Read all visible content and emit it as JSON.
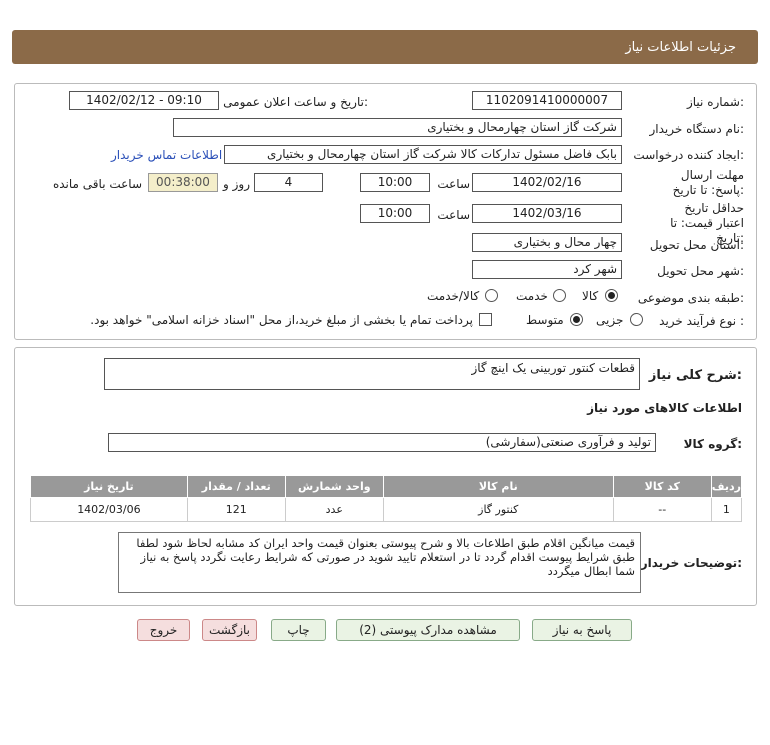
{
  "header": {
    "title": "جزئیات اطلاعات نیاز"
  },
  "form": {
    "need_number_label": "شماره نیاز:",
    "need_number": "1102091410000007",
    "announce_label": "تاریخ و ساعت اعلان عمومی:",
    "announce_value": "1402/02/12 - 09:10",
    "buyer_org_label": "نام دستگاه خریدار:",
    "buyer_org": "شرکت گاز استان چهارمحال و بختیاری",
    "requester_label": "ایجاد کننده درخواست:",
    "requester": "بابک فاضل  مسئول تدارکات کالا شرکت گاز استان چهارمحال و بختیاری",
    "contact_link": "اطلاعات تماس خریدار",
    "deadline_label": "مهلت ارسال پاسخ: تا تاریخ:",
    "deadline_date": "1402/02/16",
    "time_label": "ساعت",
    "deadline_time": "10:00",
    "days_value": "4",
    "days_label": "روز و",
    "remaining_time": "00:38:00",
    "remaining_label": "ساعت باقی مانده",
    "validity_label": "حداقل تاریخ اعتبار قیمت: تا تاریخ:",
    "validity_date": "1402/03/16",
    "validity_time": "10:00",
    "delivery_province_label": "استان محل تحویل:",
    "delivery_province": "چهار محال و بختیاری",
    "delivery_city_label": "شهر محل تحویل:",
    "delivery_city": "شهر کرد",
    "category_label": "طبقه بندی موضوعی:",
    "category_options": [
      "کالا",
      "خدمت",
      "کالا/خدمت"
    ],
    "category_selected": "کالا",
    "process_label": "نوع فرآیند خرید :",
    "process_options": [
      "جزیی",
      "متوسط"
    ],
    "process_selected": "متوسط",
    "payment_note": "پرداخت تمام یا بخشی از مبلغ خرید،از محل \"اسناد خزانه اسلامی\" خواهد بود."
  },
  "details": {
    "summary_label": "شرح کلی نیاز:",
    "summary": "قطعات کنتور توربینی یک اینچ گاز",
    "items_title": "اطلاعات کالاهای مورد نیاز",
    "group_label": "گروه کالا:",
    "group_value": "تولید و فرآوری صنعتی(سفارشی)",
    "table": {
      "headers": [
        "ردیف",
        "کد کالا",
        "نام کالا",
        "واحد شمارش",
        "تعداد / مقدار",
        "تاریخ نیاز"
      ],
      "rows": [
        [
          "1",
          "--",
          "کنتور گاز",
          "عدد",
          "121",
          "1402/03/06"
        ]
      ]
    },
    "buyer_notes_label": "توضیحات خریدار:",
    "buyer_notes": "قیمت میانگین اقلام طبق  اطلاعات بالا و شرح پیوستی بعنوان قیمت واحد  ایران کد مشابه  لحاظ شود  لطفا طبق شرایط پیوست اقدام گردد   تا در استعلام تایید شوید در صورتی که شرایط رعایت نگردد پاسخ به نیاز شما ابطال میگردد"
  },
  "buttons": {
    "reply": "پاسخ به نیاز",
    "attachments": "مشاهده مدارک پیوستی (2)",
    "print": "چاپ",
    "back": "بازگشت",
    "exit": "خروج"
  }
}
